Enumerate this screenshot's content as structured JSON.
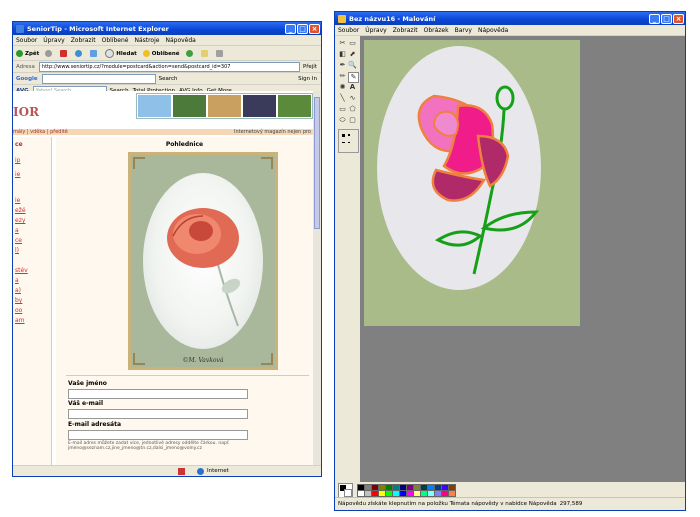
{
  "ie": {
    "title": "SeniorTip - Microsoft Internet Explorer",
    "menu": [
      "Soubor",
      "Úpravy",
      "Zobrazit",
      "Oblíbené",
      "Nástroje",
      "Nápověda"
    ],
    "toolbar": [
      "Zpět",
      "Hledat",
      "Oblíbené"
    ],
    "address_label": "Adresa",
    "address": "http://www.seniortip.cz/?module=postcard&action=send&postcard_id=307",
    "go": "Přejít",
    "google_label": "Google",
    "google_buttons": [
      "Search",
      "Sign In"
    ],
    "avg_label": "AVG",
    "avg_search_placeholder": "Yahoo! Search",
    "avg_buttons": [
      "Search",
      "Total Protection",
      "AVG Info",
      "Get More"
    ],
    "logo_text": "IOR",
    "nav_links": "mály | vděka | předitě",
    "nav_right": "Internetový magazín nejen pro",
    "sidebar_head": "ce",
    "sidebar_links": [
      "ip",
      "ie",
      "ie",
      "ežé",
      "ezy",
      "a",
      "ce",
      "l)",
      "stév",
      "a",
      "a)",
      "by",
      "oo",
      "am"
    ],
    "main_heading": "Pohlednice",
    "signature": "©M. Vavková",
    "form": {
      "name_label": "Vaše jméno",
      "email_label": "Váš e-mail",
      "target_label": "E-mail adresáta",
      "note": "E-mail adres můžete zadat více, jednotlivé adresy oddělte čárkou. např. jmeno@seznam.cz,jine_jmeno@tn.cz,dalsi_jmeno@volny.cz"
    },
    "status": "Internet"
  },
  "paint": {
    "title": "Bez názvu16 - Malování",
    "menu": [
      "Soubor",
      "Úpravy",
      "Zobrazit",
      "Obrázek",
      "Barvy",
      "Nápověda"
    ],
    "tools": [
      "select-free",
      "select-rect",
      "eraser",
      "fill",
      "picker",
      "magnifier",
      "pencil",
      "brush",
      "airbrush",
      "text",
      "line",
      "curve",
      "rect",
      "polygon",
      "ellipse",
      "rounded-rect"
    ],
    "tool_glyphs": [
      "✂",
      "▭",
      "◧",
      "⬈",
      "✒",
      "🔍",
      "✏",
      "✎",
      "✺",
      "A",
      "╲",
      "∿",
      "▭",
      "⬠",
      "⬭",
      "▢"
    ],
    "status": "Nápovědu získáte klepnutím na položku Témata nápovědy v nabídce Nápověda",
    "coords": "297,589",
    "palette_colors": [
      "#000000",
      "#808080",
      "#800000",
      "#808000",
      "#008000",
      "#008080",
      "#000080",
      "#800080",
      "#808040",
      "#004040",
      "#0080ff",
      "#004080",
      "#4000ff",
      "#804000",
      "#ffffff",
      "#c0c0c0",
      "#ff0000",
      "#ffff00",
      "#00ff00",
      "#00ffff",
      "#0000ff",
      "#ff00ff",
      "#ffff80",
      "#00ff80",
      "#80ffff",
      "#8080ff",
      "#ff0080",
      "#ff8040"
    ]
  },
  "colors": {
    "xp_blue": "#0a46d6",
    "rose_pink": "#f272c0",
    "rose_magenta": "#f01c8a",
    "rose_dark": "#b02a6a",
    "rose_outline": "#f08040",
    "stem_green": "#16a018",
    "oval_fill": "#e8e8ec",
    "canvas_bg": "#a9bb88"
  }
}
